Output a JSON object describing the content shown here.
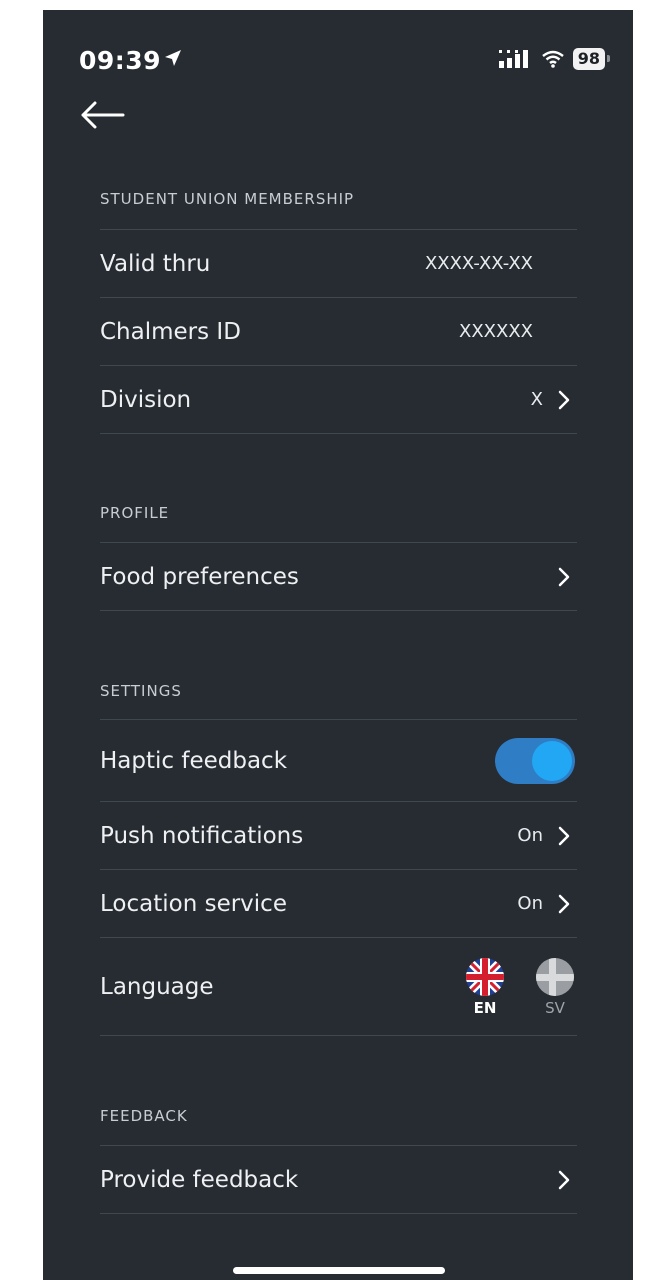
{
  "status_bar": {
    "time": "09:39",
    "battery": "98"
  },
  "sections": {
    "membership": {
      "header": "STUDENT UNION MEMBERSHIP",
      "valid_thru_label": "Valid thru",
      "valid_thru_value": "XXXX-XX-XX",
      "chalmers_id_label": "Chalmers ID",
      "chalmers_id_value": "XXXXXX",
      "division_label": "Division",
      "division_value": "X"
    },
    "profile": {
      "header": "PROFILE",
      "food_label": "Food preferences"
    },
    "settings": {
      "header": "SETTINGS",
      "haptic_label": "Haptic feedback",
      "haptic_on": true,
      "push_label": "Push notifications",
      "push_value": "On",
      "location_label": "Location service",
      "location_value": "On",
      "language_label": "Language",
      "lang_en": "EN",
      "lang_sv": "SV"
    },
    "feedback": {
      "header": "FEEDBACK",
      "provide_label": "Provide feedback"
    }
  },
  "icons": [
    "location-arrow-icon",
    "signal-icon",
    "wifi-icon",
    "battery-icon",
    "back-arrow-icon",
    "chevron-right-icon",
    "uk-flag-icon",
    "sweden-flag-icon"
  ],
  "colors": {
    "background": "#262c32",
    "toggle_track": "#2f7dc4",
    "toggle_knob": "#22a7f5"
  }
}
